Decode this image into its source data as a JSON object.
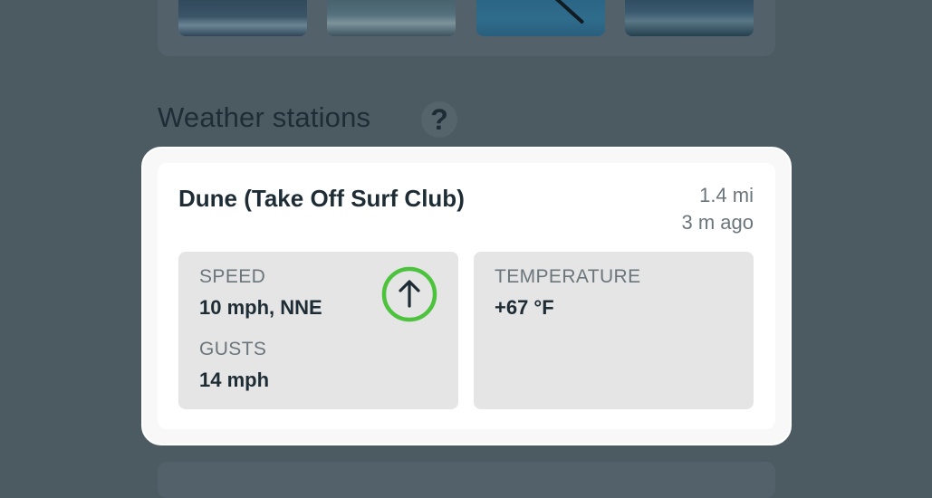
{
  "section": {
    "title": "Weather stations",
    "help_icon": "?"
  },
  "station": {
    "name": "Dune (Take Off Surf Club)",
    "distance": "1.4 mi",
    "updated": "3 m ago",
    "speed_label": "SPEED",
    "speed_value": "10 mph, NNE",
    "gusts_label": "GUSTS",
    "gusts_value": "14 mph",
    "temperature_label": "TEMPERATURE",
    "temperature_value": "+67 °F",
    "wind_direction_icon": "arrow-up-icon",
    "accent_color": "#4cc23d"
  }
}
